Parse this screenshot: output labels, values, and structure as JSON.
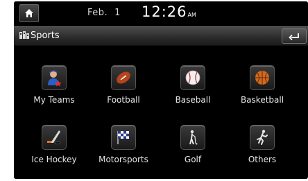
{
  "status_bar": {
    "month": "Feb.",
    "day": "1",
    "time": "12:26",
    "ampm": "AM"
  },
  "header": {
    "title": "Sports"
  },
  "categories": [
    {
      "label": "My Teams",
      "icon": "my-teams-icon"
    },
    {
      "label": "Football",
      "icon": "football-icon"
    },
    {
      "label": "Baseball",
      "icon": "baseball-icon"
    },
    {
      "label": "Basketball",
      "icon": "basketball-icon"
    },
    {
      "label": "Ice Hockey",
      "icon": "ice-hockey-icon"
    },
    {
      "label": "Motorsports",
      "icon": "motorsports-icon"
    },
    {
      "label": "Golf",
      "icon": "golf-icon"
    },
    {
      "label": "Others",
      "icon": "others-icon"
    }
  ],
  "colors": {
    "background": "#000000",
    "text": "#e6e6e6",
    "football": "#b4441c",
    "basketball": "#d2691e",
    "baseball": "#f0f0f0"
  }
}
